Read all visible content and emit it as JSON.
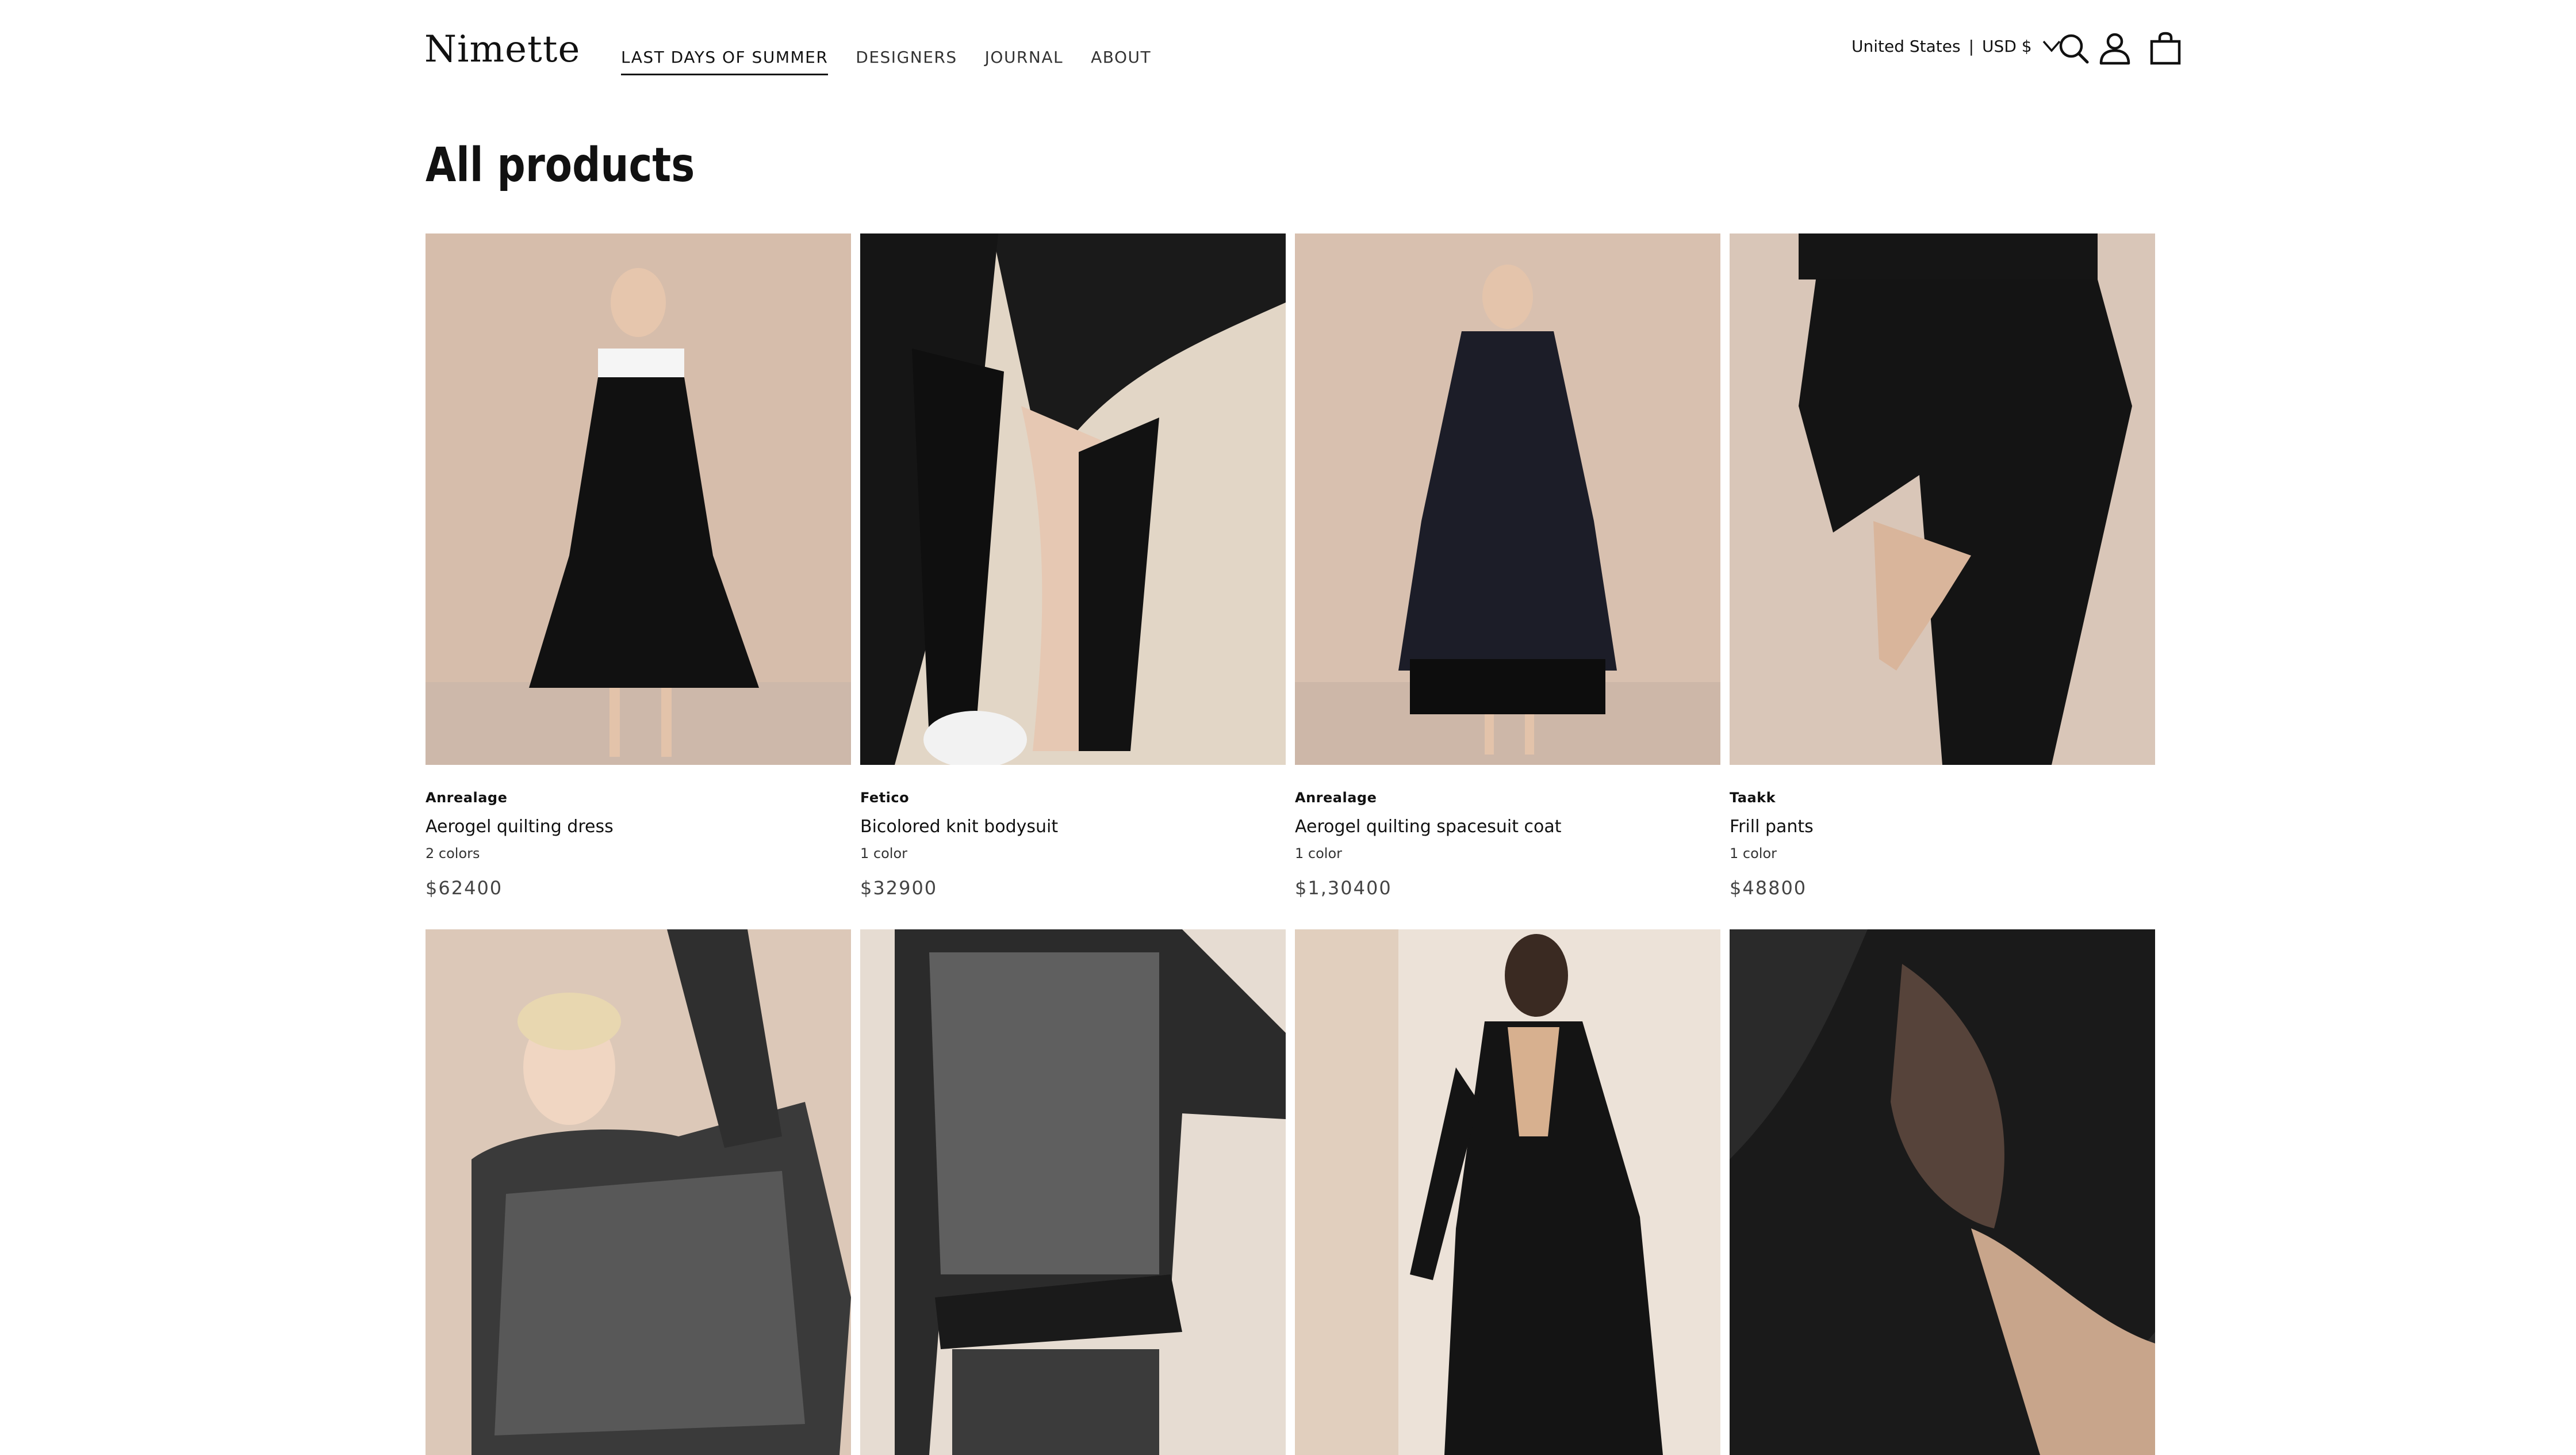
{
  "header": {
    "logo": "Nimette",
    "nav": [
      {
        "label": "LAST DAYS OF SUMMER",
        "active": true
      },
      {
        "label": "DESIGNERS"
      },
      {
        "label": "JOURNAL"
      },
      {
        "label": "ABOUT"
      }
    ],
    "locale": {
      "country": "United States",
      "separator": "|",
      "currency": "USD $"
    },
    "icons": [
      "chevron-down-icon",
      "search-icon",
      "account-icon",
      "cart-icon"
    ]
  },
  "page": {
    "title": "All products"
  },
  "products": [
    {
      "designer": "Anrealage",
      "name": "Aerogel quilting dress",
      "colors": "2 colors",
      "price": "$62400"
    },
    {
      "designer": "Fetico",
      "name": "Bicolored knit bodysuit",
      "colors": "1 color",
      "price": "$32900"
    },
    {
      "designer": "Anrealage",
      "name": "Aerogel quilting spacesuit coat",
      "colors": "1 color",
      "price": "$1,30400"
    },
    {
      "designer": "Taakk",
      "name": "Frill pants",
      "colors": "1 color",
      "price": "$48800"
    },
    {},
    {},
    {},
    {}
  ],
  "colors": {
    "text": "#111111",
    "muted": "#444444",
    "photo_backdrop": "#d9c3b4"
  }
}
